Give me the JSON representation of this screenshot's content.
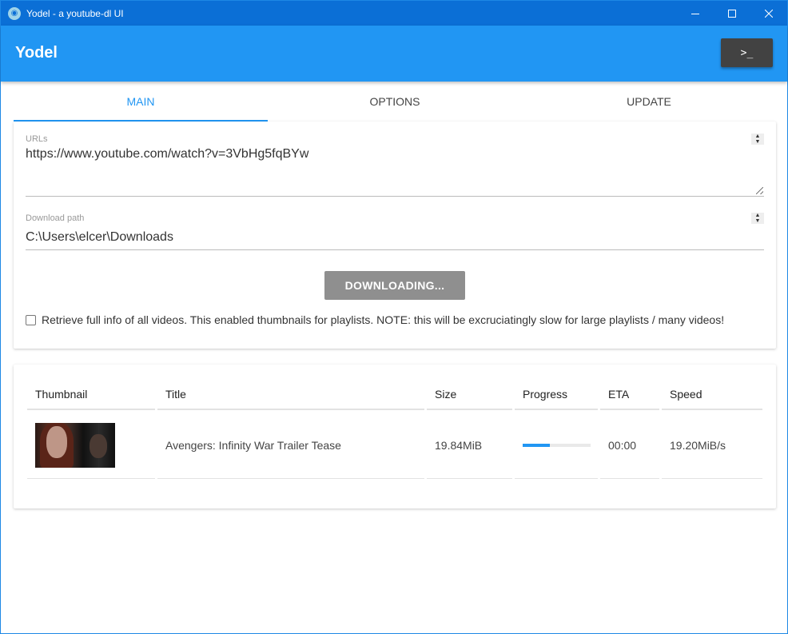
{
  "window": {
    "title": "Yodel - a youtube-dl UI"
  },
  "appbar": {
    "title": "Yodel",
    "console_label": ">_"
  },
  "tabs": [
    {
      "label": "MAIN",
      "active": true
    },
    {
      "label": "OPTIONS",
      "active": false
    },
    {
      "label": "UPDATE",
      "active": false
    }
  ],
  "main": {
    "urls": {
      "label": "URLs",
      "value": "https://www.youtube.com/watch?v=3VbHg5fqBYw"
    },
    "download_path": {
      "label": "Download path",
      "value": "C:\\Users\\elcer\\Downloads"
    },
    "download_button": "DOWNLOADING...",
    "full_info_checkbox": {
      "checked": false,
      "label": "Retrieve full info of all videos. This enabled thumbnails for playlists. NOTE: this will be excruciatingly slow for large playlists / many videos!"
    }
  },
  "table": {
    "columns": [
      "Thumbnail",
      "Title",
      "Size",
      "Progress",
      "ETA",
      "Speed"
    ],
    "rows": [
      {
        "title": "Avengers: Infinity War Trailer Tease",
        "size": "19.84MiB",
        "progress": 0.4,
        "eta": "00:00",
        "speed": "19.20MiB/s"
      }
    ]
  },
  "colors": {
    "accent": "#2196f3",
    "titlebar": "#0b6fd6",
    "button_disabled": "#8f8f8f"
  }
}
